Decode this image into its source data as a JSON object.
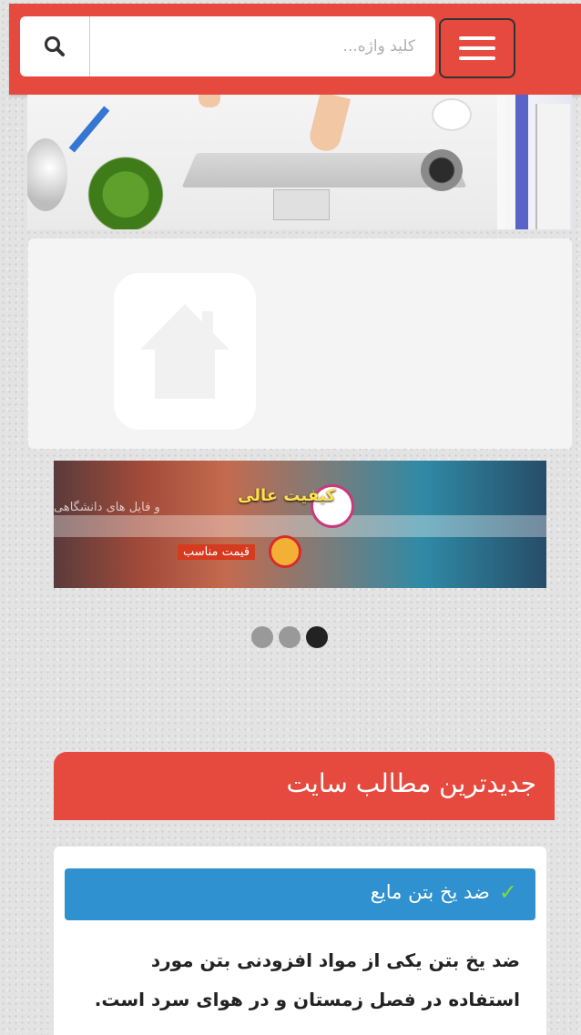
{
  "header": {
    "search_placeholder": "کلید واژه...",
    "search_icon": "magnifier-icon",
    "menu_icon": "hamburger-icon",
    "accent_color": "#e64a3f"
  },
  "banner": {
    "headline": "کیفیت عالی",
    "faint_text": "و فایل های دانشگاهی",
    "badge": "قیمت مناسب"
  },
  "slider": {
    "dot_count": 3,
    "active_index": 2
  },
  "latest": {
    "title": "جدیدترین مطالب سایت",
    "post": {
      "title": "ضد یخ بتن مایع",
      "excerpt": "ضد یخ بتن یکی از مواد افزودنی بتن مورد استفاده در فصل زمستان و در هوای سرد است.",
      "title_bar_color": "#2f91cf"
    }
  }
}
